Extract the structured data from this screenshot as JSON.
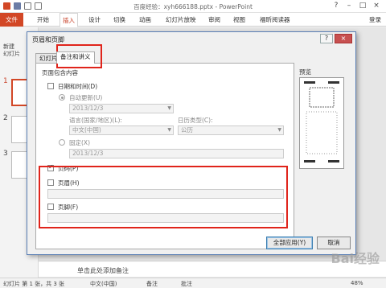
{
  "window": {
    "title": "百度经验：xyh666188.pptx - PowerPoint"
  },
  "ribbon": {
    "tabs": [
      "文件",
      "开始",
      "插入",
      "设计",
      "切换",
      "动画",
      "幻灯片放映",
      "审阅",
      "视图",
      "福昕阅读器"
    ],
    "active_tab": "插入",
    "login": "登录"
  },
  "left_pane": {
    "new_slide_line1": "新建",
    "new_slide_line2": "幻灯片",
    "slide_numbers": [
      "1",
      "2",
      "3"
    ]
  },
  "notes_placeholder": "单击此处添加备注",
  "status": {
    "slide_info": "幻灯片 第 1 张，共 3 张",
    "language": "中文(中国)",
    "notes": "备注",
    "comments": "批注",
    "zoom": "48%"
  },
  "dialog": {
    "title": "页眉和页脚",
    "help": "?",
    "close": "×",
    "tabs": [
      "幻灯片",
      "备注和讲义"
    ],
    "active_tab": "备注和讲义",
    "section_title": "页面包含内容",
    "date_time": {
      "label": "日期和时间(D)",
      "checked": false
    },
    "auto_update": {
      "label": "自动更新(U)",
      "value": "2013/12/3"
    },
    "language": {
      "label": "语言(国家/地区)(L):",
      "value": "中文(中国)"
    },
    "calendar": {
      "label": "日历类型(C):",
      "value": "公历"
    },
    "fixed": {
      "label": "固定(X)",
      "value": "2013/12/3"
    },
    "page_number": {
      "label": "页码(P)",
      "checked": true
    },
    "header": {
      "label": "页眉(H)",
      "checked": false
    },
    "footer": {
      "label": "页脚(F)",
      "checked": false
    },
    "preview_label": "预览",
    "apply_all": "全部应用(Y)",
    "cancel": "取消"
  },
  "watermark": "Bai经验",
  "colors": {
    "accent": "#d24726",
    "highlight": "#e0241b"
  }
}
